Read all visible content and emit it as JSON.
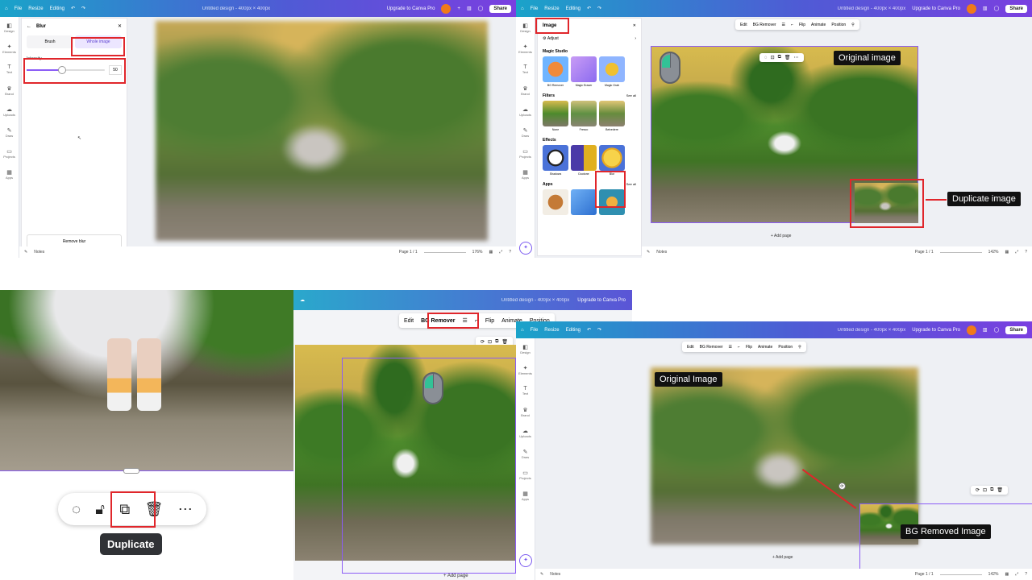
{
  "topbar": {
    "file": "File",
    "resize": "Resize",
    "editing": "Editing",
    "doc_title": "Untitled design - 400px × 400px",
    "upgrade": "Upgrade to Canva Pro",
    "avatar_letter": "J",
    "share": "Share"
  },
  "rail": [
    "Design",
    "Elements",
    "Text",
    "Brand",
    "Uploads",
    "Draw",
    "Projects",
    "Apps"
  ],
  "panel1": {
    "back": "Blur",
    "tabs": [
      "Brush",
      "Whole image"
    ],
    "intensity_label": "Intensity",
    "intensity_value": "50",
    "remove": "Remove blur",
    "notes": "Notes",
    "page": "Page 1 / 1",
    "zoom": "176%"
  },
  "panel2": {
    "header": "Image",
    "adjust": "Adjust",
    "magic_studio": "Magic Studio",
    "magic_items": [
      "BG Remover",
      "Magic Eraser",
      "Magic Grab"
    ],
    "filters": "Filters",
    "see_all": "See all",
    "filter_items": [
      "None",
      "Fresco",
      "Belvedere"
    ],
    "effects": "Effects",
    "effect_items": [
      "Shadows",
      "Duotone",
      "Blur"
    ],
    "apps": "Apps",
    "toolbar": [
      "Edit",
      "BG Remover",
      "Flip",
      "Animate",
      "Position"
    ],
    "original_label": "Original image",
    "duplicate_label": "Duplicate image",
    "add_page": "+ Add page",
    "notes": "Notes",
    "page": "Page 1 / 1",
    "zoom": "142%"
  },
  "panel3": {
    "tooltip": "Duplicate"
  },
  "panel4": {
    "toolbar": [
      "Edit",
      "BG Remover",
      "Flip",
      "Animate",
      "Position"
    ],
    "add_page": "+ Add page"
  },
  "panel5": {
    "toolbar": [
      "Edit",
      "BG Remover",
      "Flip",
      "Animate",
      "Position"
    ],
    "original_label": "Original Image",
    "removed_label": "BG Removed Image",
    "add_page": "+ Add page",
    "notes": "Notes",
    "page": "Page 1 / 1",
    "zoom": "142%"
  }
}
